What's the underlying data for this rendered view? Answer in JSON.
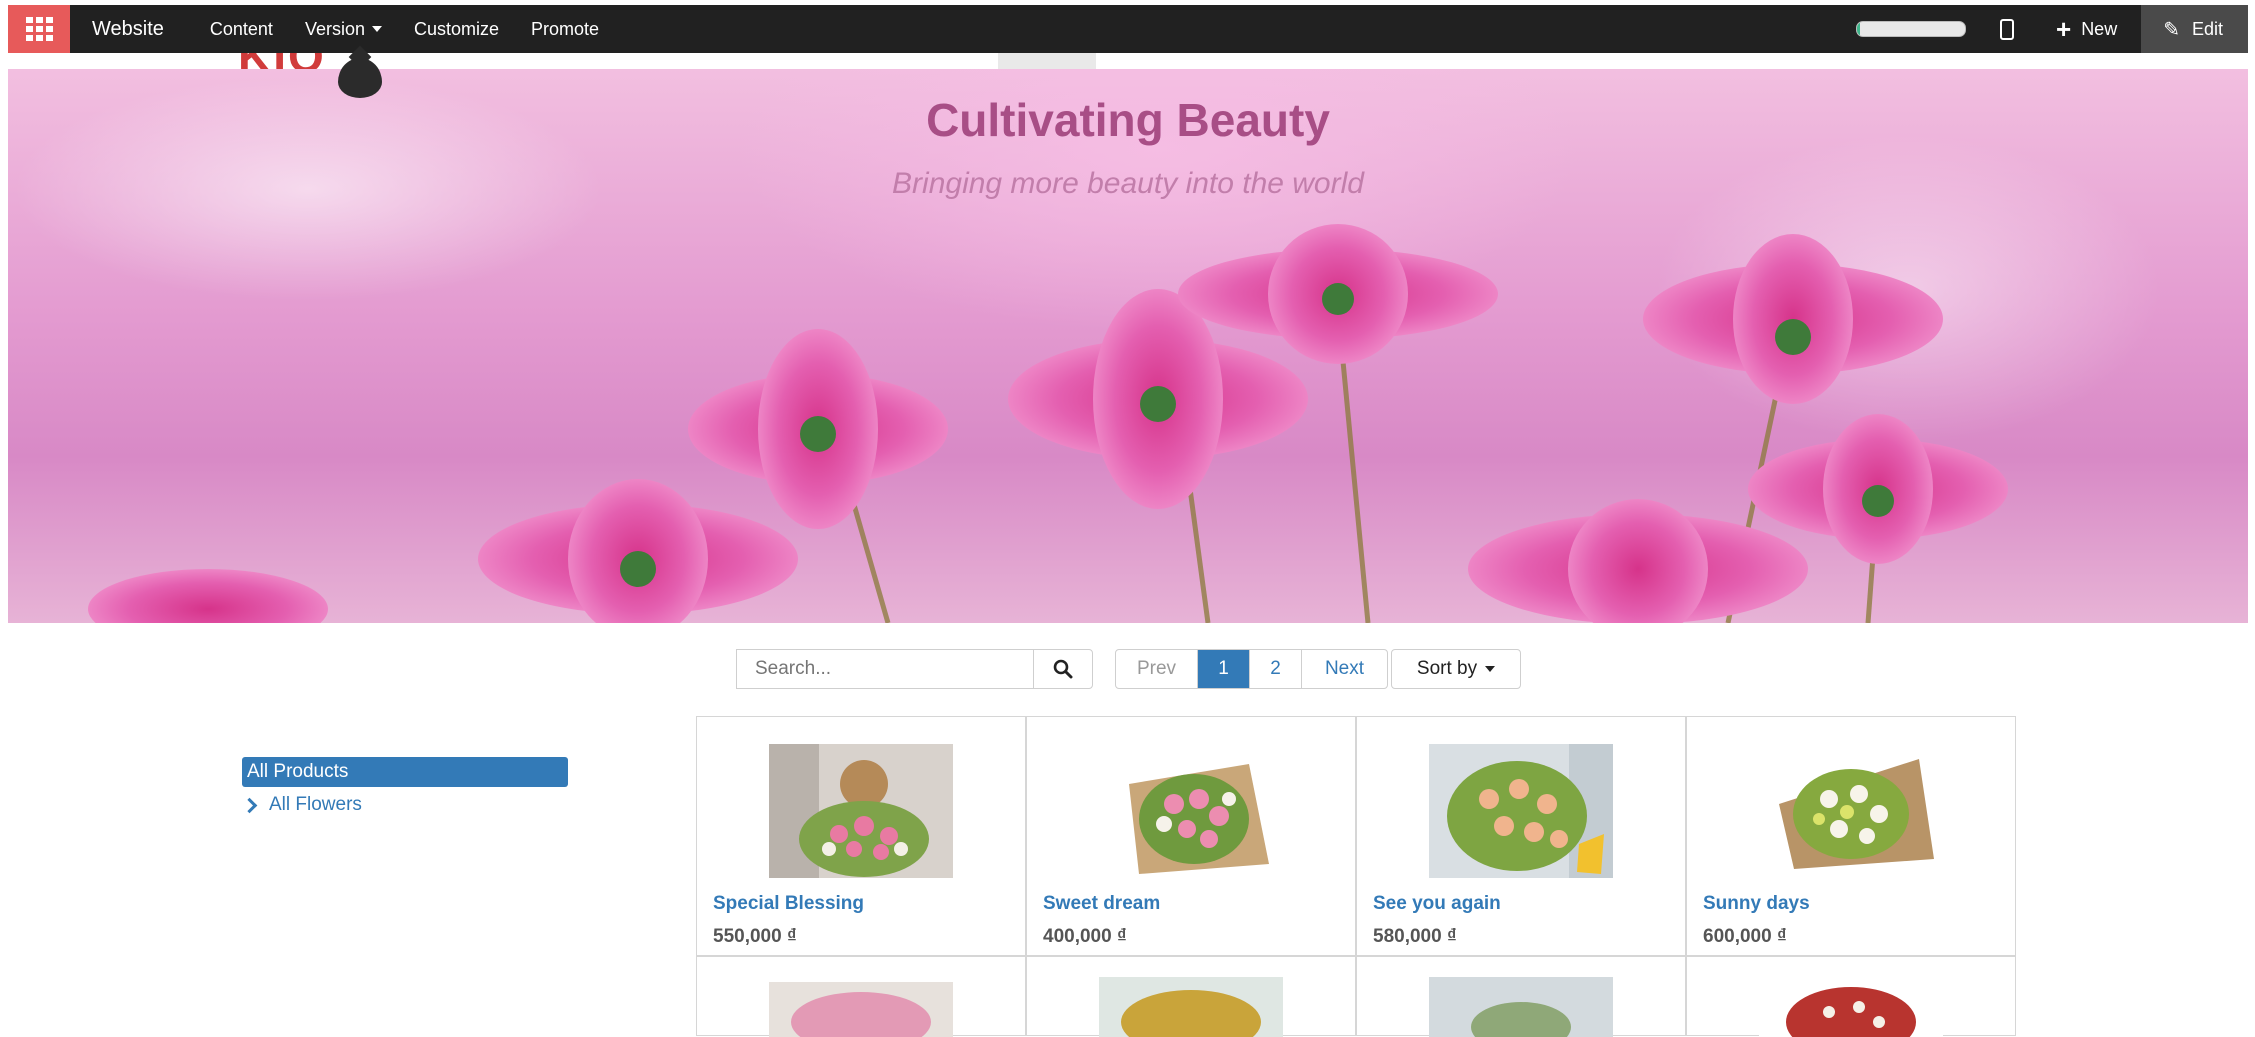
{
  "topbar": {
    "brand": "Website",
    "menu": [
      "Content",
      "Version",
      "Customize",
      "Promote"
    ],
    "progress_fraction": 0.03,
    "new_label": "New",
    "edit_label": "Edit"
  },
  "banner": {
    "title": "Cultivating Beauty",
    "subtitle": "Bringing more beauty into the world"
  },
  "search": {
    "placeholder": "Search..."
  },
  "pager": {
    "prev": "Prev",
    "pages": [
      "1",
      "2"
    ],
    "next": "Next",
    "active": "1"
  },
  "sort": {
    "label": "Sort by"
  },
  "sidebar": {
    "active": "All Products",
    "child": "All Flowers"
  },
  "products": [
    {
      "name": "Special Blessing",
      "price": "550,000 ₫"
    },
    {
      "name": "Sweet dream",
      "price": "400,000 ₫"
    },
    {
      "name": "See you again",
      "price": "580,000 ₫"
    },
    {
      "name": "Sunny days",
      "price": "600,000 ₫"
    }
  ],
  "colors": {
    "accent": "#337ab7",
    "topbar_bg": "#212121",
    "apps_button": "#e75a5a",
    "title_color": "#a84e86"
  }
}
